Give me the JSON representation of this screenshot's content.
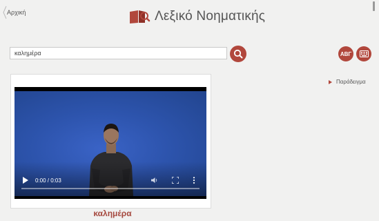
{
  "nav": {
    "back_label": "Αρχική"
  },
  "header": {
    "title": "Λεξικό Νοηματικής",
    "logo_icon": "book-magnifier-icon"
  },
  "search": {
    "value": "καλημέρα"
  },
  "buttons": {
    "abc_label": "ΑΒΓ",
    "keyboard_icon": "keyboard-icon",
    "search_icon": "search-icon"
  },
  "side": {
    "example_label": "Παράδειγμα"
  },
  "video": {
    "time": "0:00 / 0:03",
    "progress": 0
  },
  "result": {
    "word": "καλημέρα"
  },
  "colors": {
    "accent": "#b1473c",
    "background": "#f1f1f0",
    "video_bg": "#2a4fa3"
  }
}
